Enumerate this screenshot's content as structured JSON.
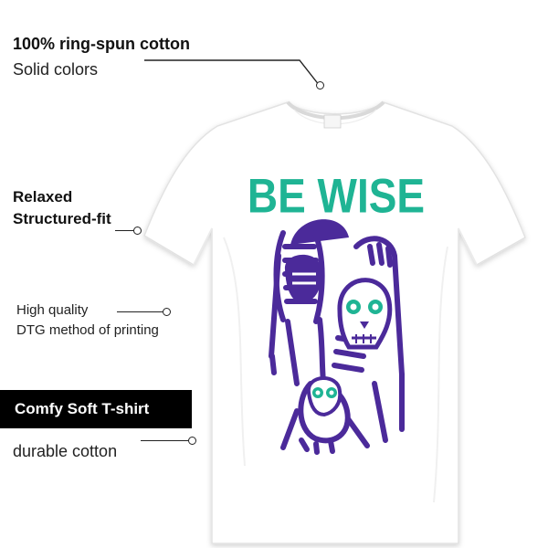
{
  "features": {
    "cotton": {
      "title": "100% ring-spun cotton",
      "subtitle": "Solid colors"
    },
    "fit": {
      "title": "Relaxed",
      "subtitle": "Structured-fit"
    },
    "print": {
      "title": "High quality",
      "subtitle": "DTG method of printing"
    },
    "badge": {
      "title": "Comfy Soft T-shirt",
      "subtitle": "durable cotton"
    }
  },
  "shirt": {
    "graphic_text": "BE WISE",
    "colors": {
      "shirt": "#ffffff",
      "graphic_text": "#1fb494",
      "graphic_art": "#4b2a9a"
    }
  }
}
